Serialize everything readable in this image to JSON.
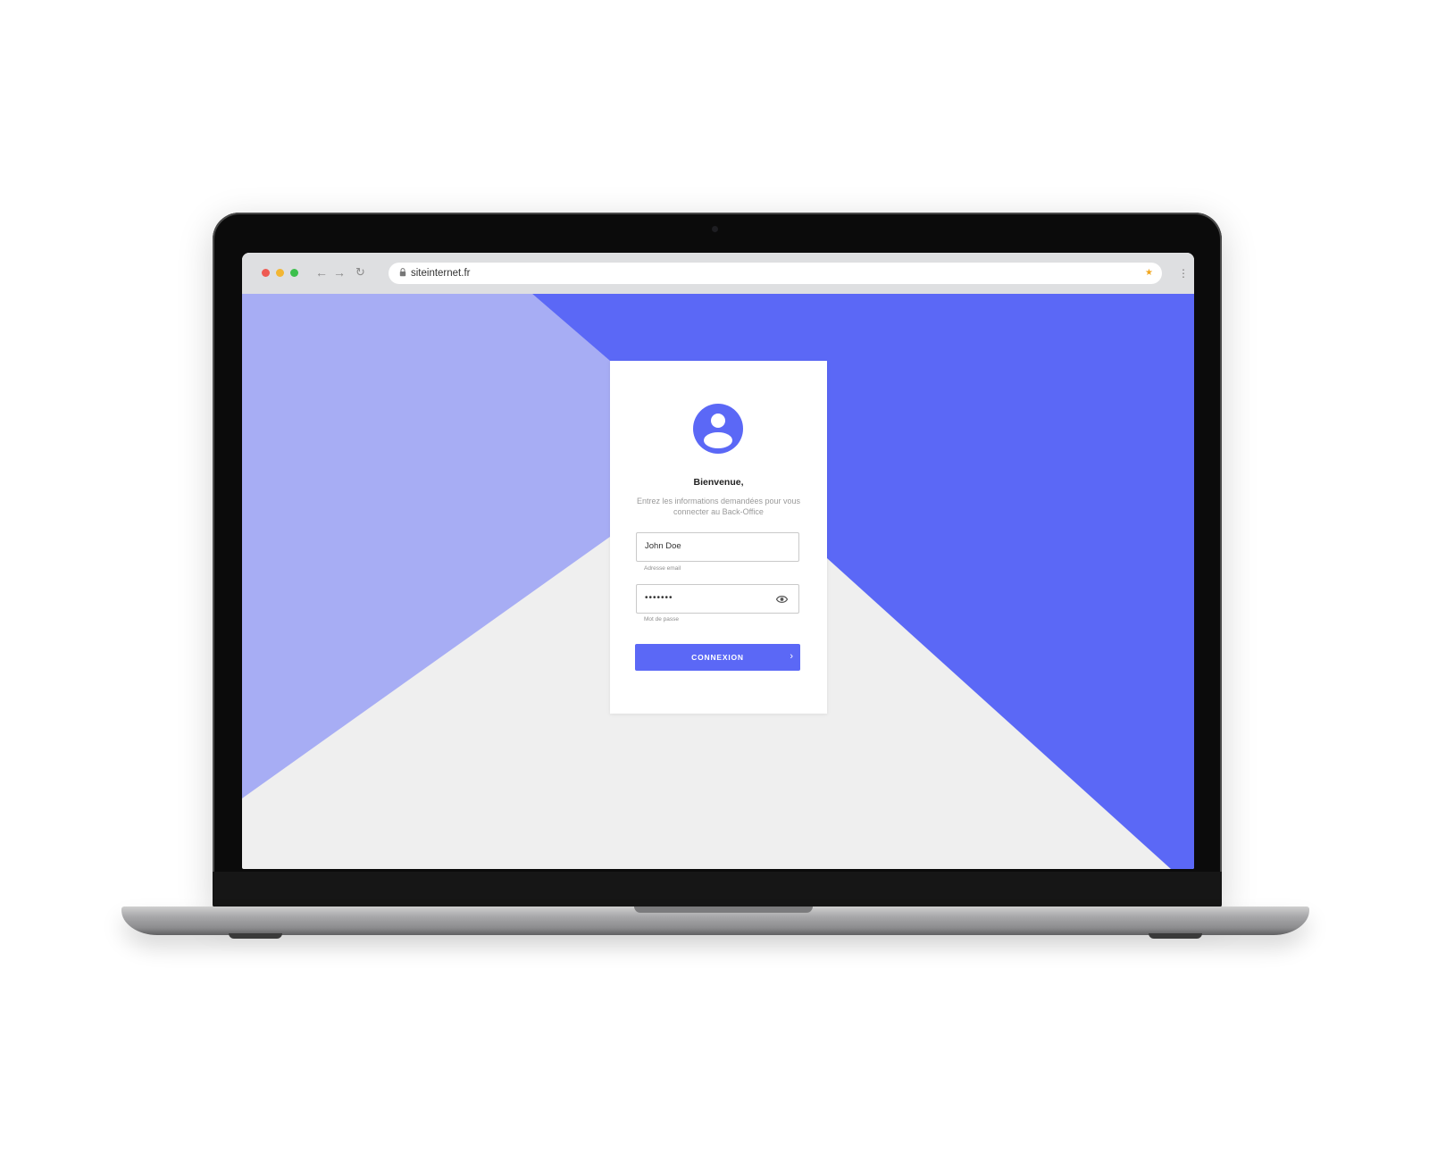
{
  "browser": {
    "url": "siteinternet.fr",
    "icons": [
      "back-arrow-icon",
      "forward-arrow-icon",
      "reload-icon",
      "lock-icon",
      "bookmark-star-icon",
      "more-options-icon"
    ]
  },
  "login": {
    "title": "Bienvenue,",
    "subtitle": "Entrez les informations demandées pour vous connecter au Back-Office",
    "email": {
      "value": "John Doe",
      "helper": "Adresse email"
    },
    "password": {
      "value": "•••••••",
      "helper": "Mot de passe"
    },
    "submit_label": "CONNEXION"
  },
  "colors": {
    "accent": "#5b68f6",
    "accent_light": "#a7adf4",
    "background": "#efefef"
  }
}
